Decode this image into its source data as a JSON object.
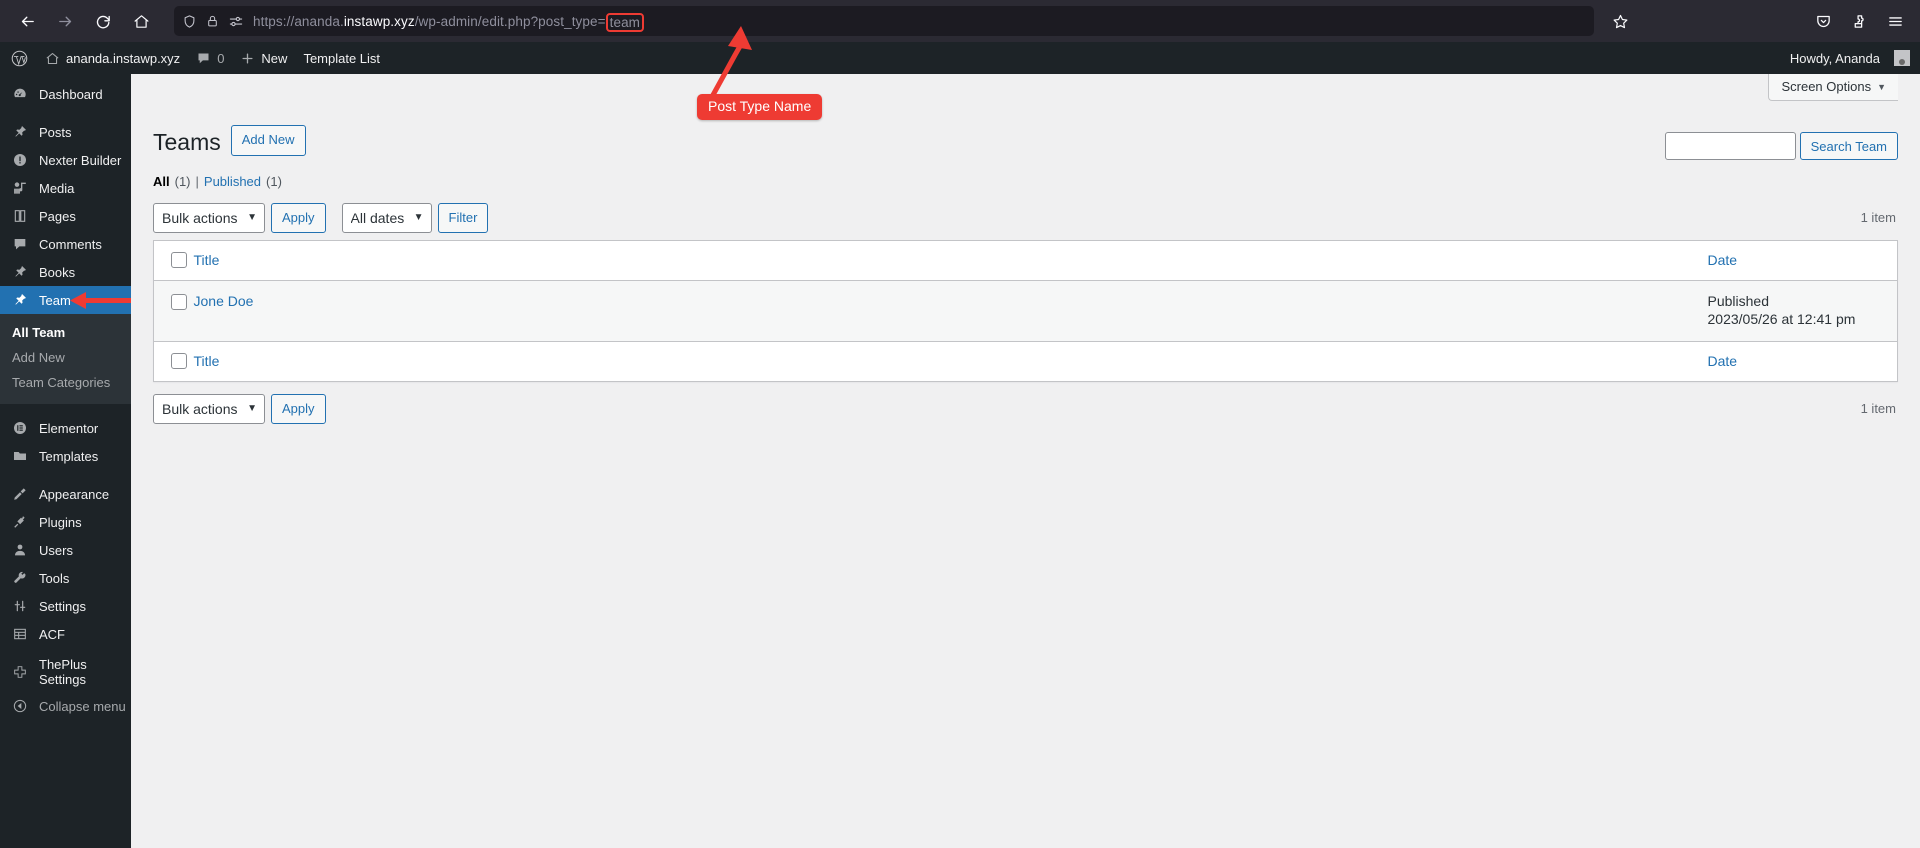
{
  "browser": {
    "nav": {
      "back_icon": "arrow-left-icon",
      "forward_icon": "arrow-right-icon",
      "reload_icon": "reload-icon",
      "home_icon": "home-icon"
    },
    "url": {
      "shield_icon": "shield-icon",
      "lock_icon": "lock-icon",
      "permissions_icon": "site-permissions-icon",
      "prefix": "https://ananda.",
      "host_strong": "instawp.xyz",
      "path": "/wp-admin/edit.php?post_type=",
      "highlighted_value": "team",
      "full": "https://ananda.instawp.xyz/wp-admin/edit.php?post_type=team"
    },
    "bookmark_icon": "star-icon",
    "right_icons": [
      "pocket-icon",
      "extensions-icon",
      "app-menu-icon"
    ]
  },
  "adminbar": {
    "wp_logo": "wordpress-logo-icon",
    "site_icon": "home-icon",
    "site_name": "ananda.instawp.xyz",
    "comments_icon": "comment-bubble-icon",
    "comments_count": "0",
    "new_icon": "plus-icon",
    "new_label": "New",
    "template_list_label": "Template List",
    "howdy": "Howdy, Ananda",
    "avatar": "user-avatar"
  },
  "sidebar": {
    "items": [
      {
        "label": "Dashboard",
        "icon": "dashboard-icon",
        "current": false,
        "sep_after": true
      },
      {
        "label": "Posts",
        "icon": "pin-icon",
        "current": false,
        "sep_after": false
      },
      {
        "label": "Nexter Builder",
        "icon": "exclamation-circle-icon",
        "current": false,
        "sep_after": false
      },
      {
        "label": "Media",
        "icon": "media-icon",
        "current": false,
        "sep_after": false
      },
      {
        "label": "Pages",
        "icon": "pages-icon",
        "current": false,
        "sep_after": false
      },
      {
        "label": "Comments",
        "icon": "comment-bubble-icon",
        "current": false,
        "sep_after": false
      },
      {
        "label": "Books",
        "icon": "pin-icon",
        "current": false,
        "sep_after": false
      },
      {
        "label": "Team",
        "icon": "pin-icon",
        "current": true,
        "sep_after": false
      }
    ],
    "submenu": {
      "items": [
        {
          "label": "All Team",
          "current": true
        },
        {
          "label": "Add New",
          "current": false
        },
        {
          "label": "Team Categories",
          "current": false
        }
      ]
    },
    "items_after": [
      {
        "label": "Elementor",
        "icon": "elementor-icon",
        "sep_after": false
      },
      {
        "label": "Templates",
        "icon": "folder-icon",
        "sep_after": true
      },
      {
        "label": "Appearance",
        "icon": "brush-icon",
        "sep_after": false
      },
      {
        "label": "Plugins",
        "icon": "plug-icon",
        "sep_after": false
      },
      {
        "label": "Users",
        "icon": "users-icon",
        "sep_after": false
      },
      {
        "label": "Tools",
        "icon": "wrench-icon",
        "sep_after": false
      },
      {
        "label": "Settings",
        "icon": "sliders-icon",
        "sep_after": false
      },
      {
        "label": "ACF",
        "icon": "grid-table-icon",
        "sep_after": true
      },
      {
        "label": "ThePlus Settings",
        "icon": "theplus-icon",
        "sep_after": false
      }
    ],
    "collapse": {
      "label": "Collapse menu",
      "icon": "chevron-left-circle-icon"
    }
  },
  "screen_meta": {
    "screen_options_label": "Screen Options",
    "caret_icon": "chevron-down-icon"
  },
  "page": {
    "title": "Teams",
    "add_new_label": "Add New"
  },
  "views": {
    "all_label": "All",
    "all_count": "(1)",
    "divider": "|",
    "published_label": "Published",
    "published_count": "(1)"
  },
  "tablenav_top": {
    "bulk_actions_value": "Bulk actions",
    "apply_label": "Apply",
    "dates_value": "All dates",
    "filter_label": "Filter",
    "displaying_num": "1 item"
  },
  "tablenav_bottom": {
    "bulk_actions_value": "Bulk actions",
    "apply_label": "Apply",
    "displaying_num": "1 item"
  },
  "search": {
    "value": "",
    "placeholder": "",
    "submit_label": "Search Team"
  },
  "table": {
    "columns": {
      "checkbox": "select-all-checkbox",
      "title": "Title",
      "date": "Date"
    },
    "rows": [
      {
        "title": "Jone Doe",
        "date_status": "Published",
        "date_value": "2023/05/26 at 12:41 pm"
      }
    ]
  },
  "annotations": {
    "post_type_name": "Post Type Name",
    "accent_color": "#ee3b33"
  }
}
